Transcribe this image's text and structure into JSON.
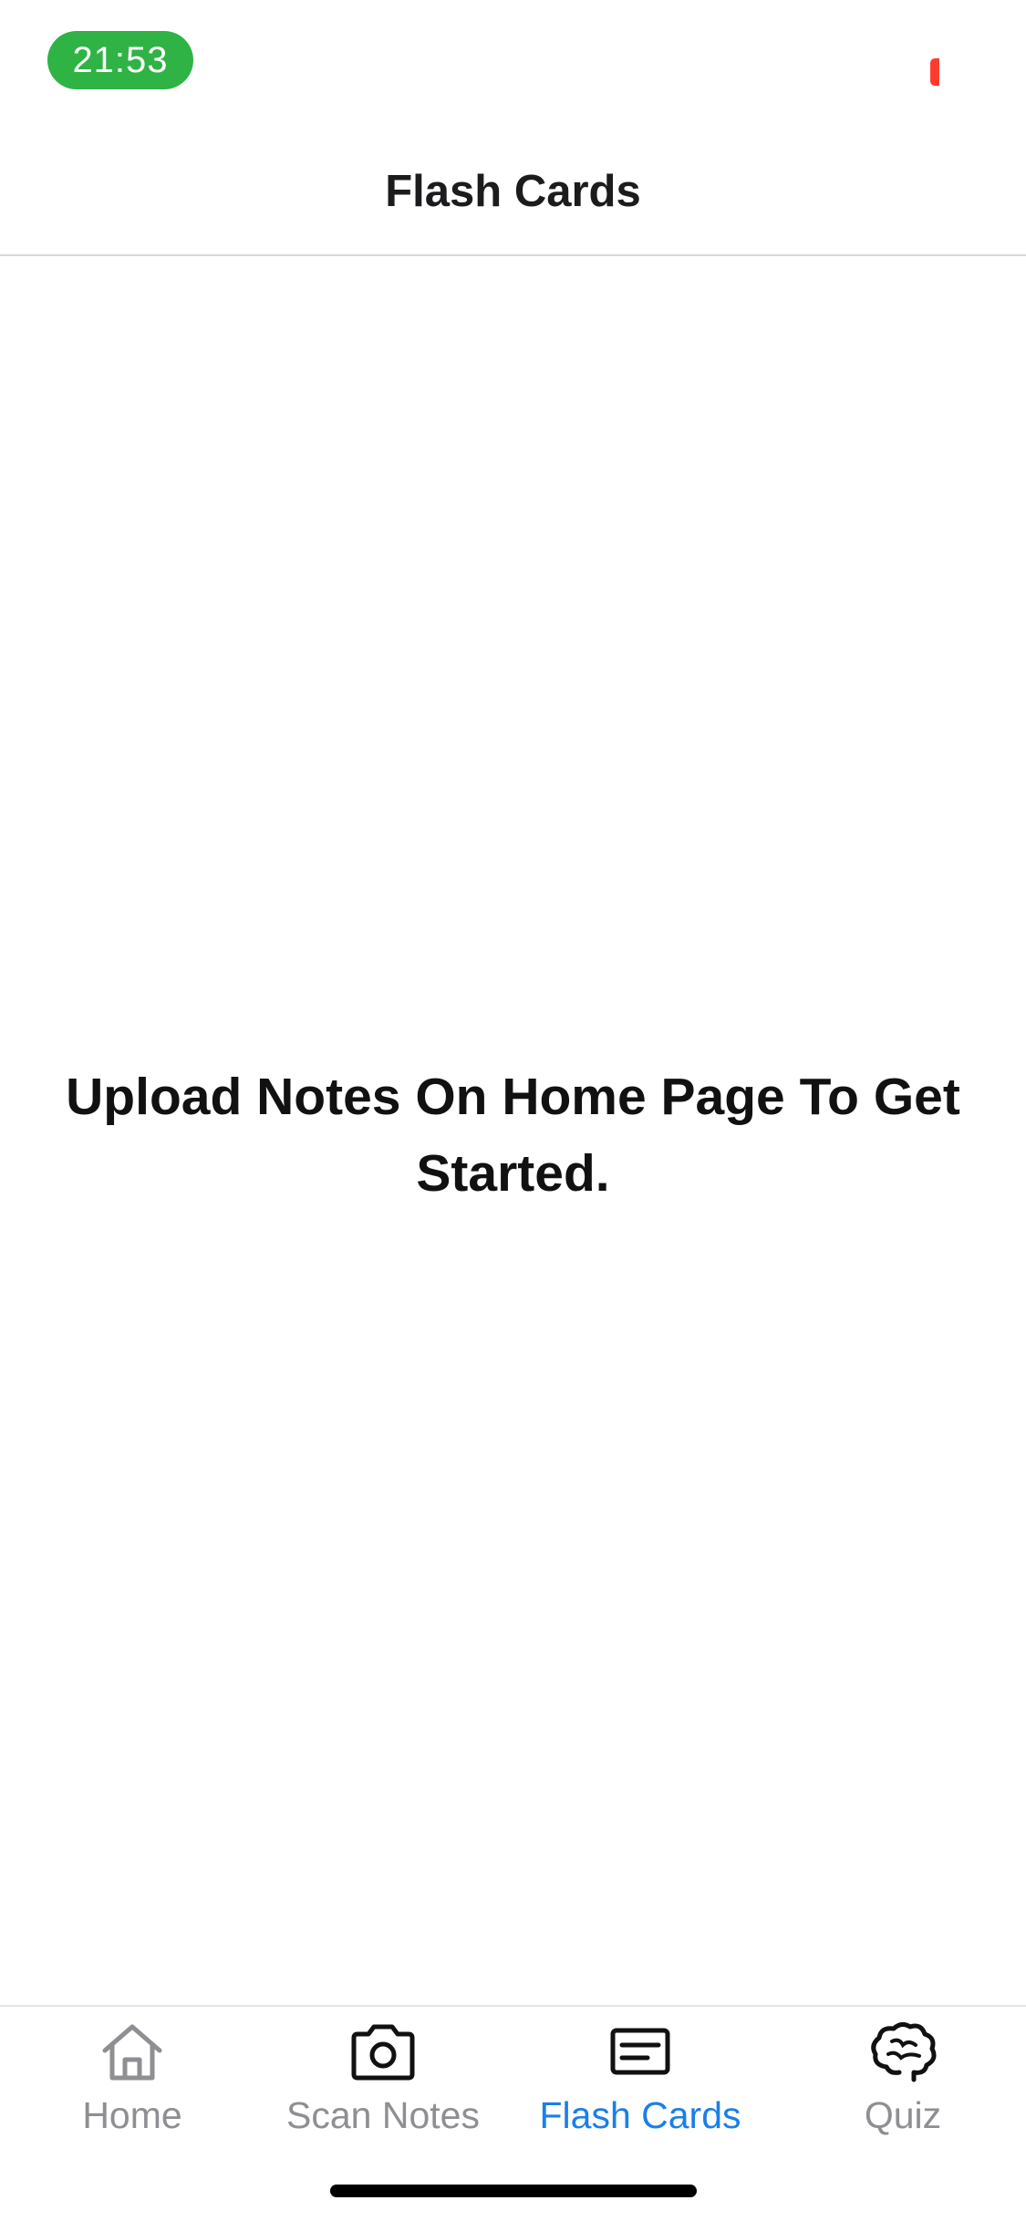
{
  "status_bar": {
    "time": "21:53",
    "time_pill_color": "#2fb344",
    "recording_indicator_color": "#ff3b30"
  },
  "header": {
    "title": "Flash Cards"
  },
  "main": {
    "empty_message": "Upload Notes On Home Page To Get Started."
  },
  "tab_bar": {
    "active_color": "#1a7fe8",
    "inactive_color": "#8e8e93",
    "tabs": [
      {
        "label": "Home",
        "icon": "home-icon",
        "active": false
      },
      {
        "label": "Scan Notes",
        "icon": "camera-icon",
        "active": false
      },
      {
        "label": "Flash Cards",
        "icon": "card-icon",
        "active": true
      },
      {
        "label": "Quiz",
        "icon": "brain-icon",
        "active": false
      }
    ]
  }
}
